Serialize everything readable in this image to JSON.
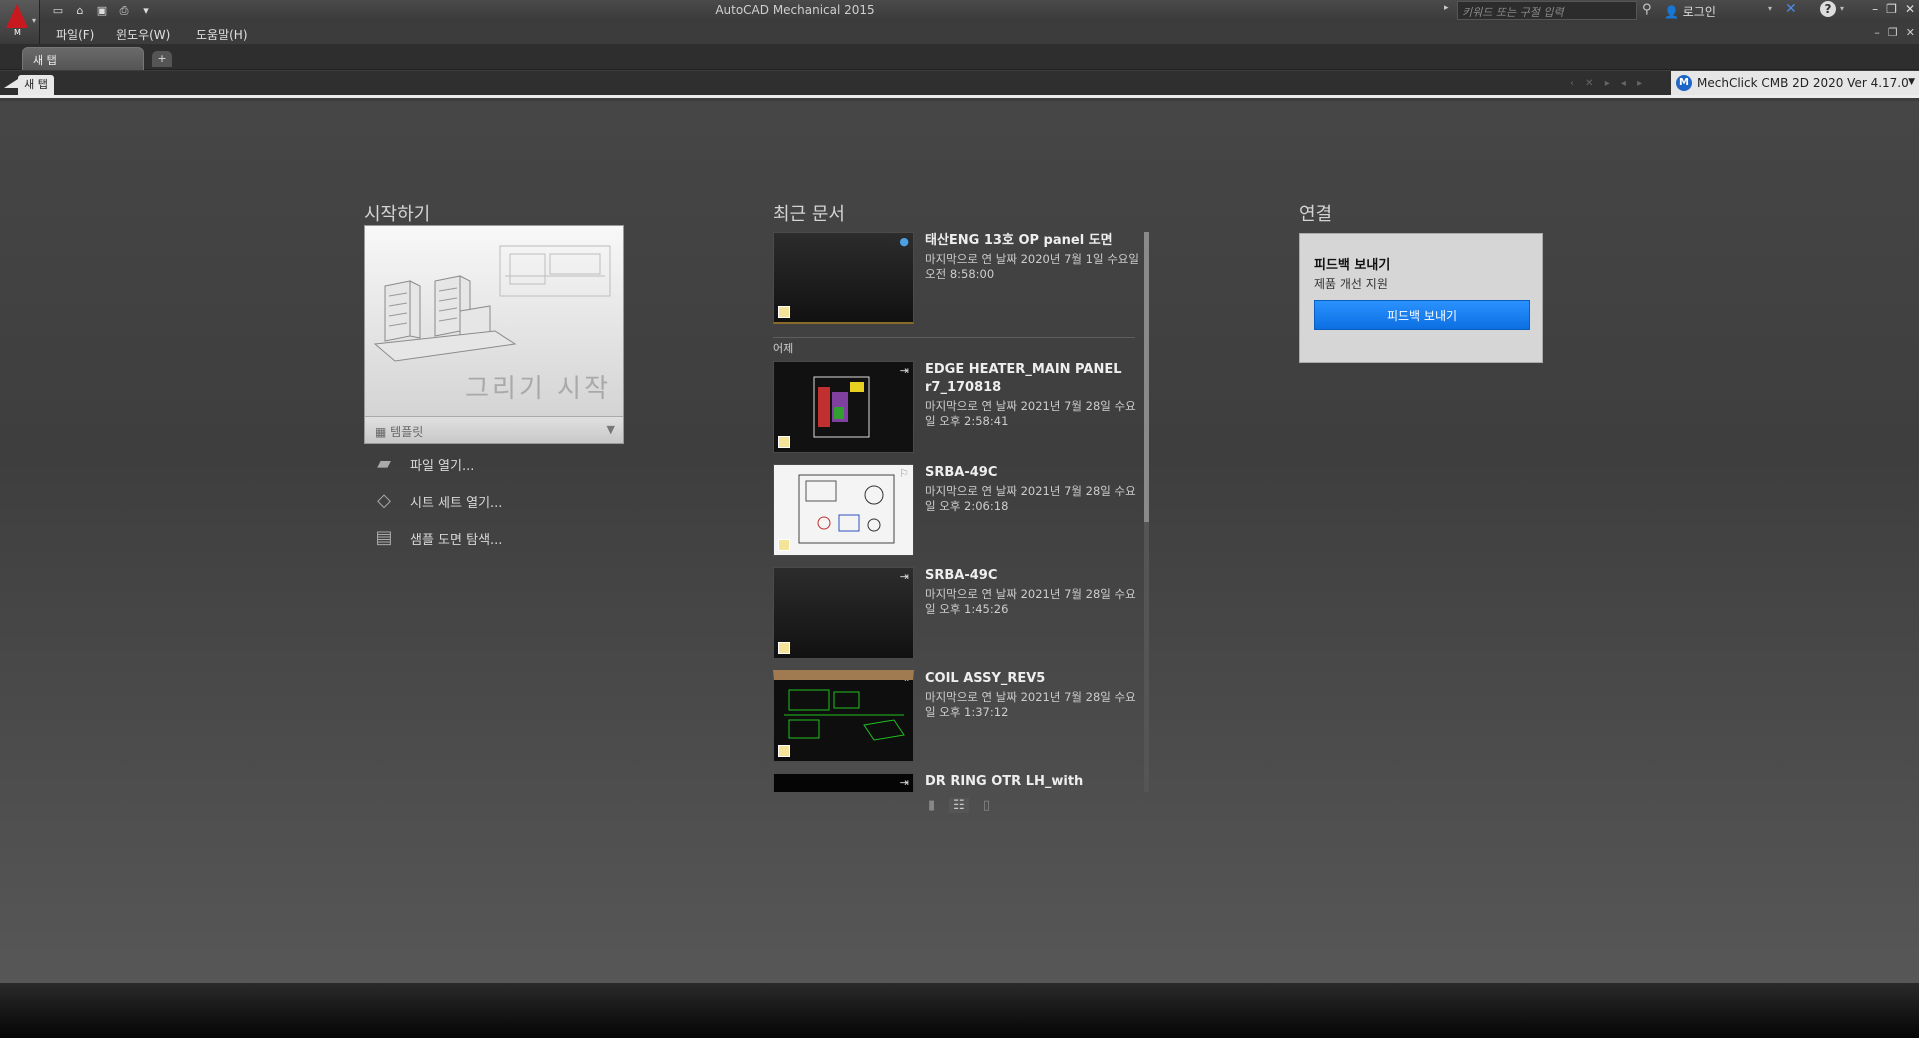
{
  "window": {
    "title": "AutoCAD Mechanical 2015",
    "search_placeholder": "키워드 또는 구절 입력",
    "login_label": "로그인"
  },
  "menu": {
    "items": [
      "파일(F)",
      "윈도우(W)",
      "도움말(H)"
    ]
  },
  "file_tabs": {
    "active": "새 탭",
    "add": "+"
  },
  "doc_tabs": {
    "active": "새 탭",
    "plugin": "MechClick CMB 2D 2020  Ver 4.17.0"
  },
  "start": {
    "title": "시작하기",
    "card_label": "그리기 시작",
    "template_label": "템플릿",
    "links": [
      "파일 열기...",
      "시트 세트 열기...",
      "샘플 도면 탐색..."
    ]
  },
  "recent": {
    "title": "최근 문서",
    "group_label": "어제",
    "items": [
      {
        "name": "태산ENG 13호 OP panel 도면",
        "meta": "마지막으로 연 날짜 2020년 7월 1일 수요일 오전 8:58:00"
      },
      {
        "name": "EDGE HEATER_MAIN PANEL r7_170818",
        "meta": "마지막으로 연 날짜 2021년 7월 28일 수요일 오후 2:58:41"
      },
      {
        "name": "SRBA-49C",
        "meta": "마지막으로 연 날짜 2021년 7월 28일 수요일 오후 2:06:18"
      },
      {
        "name": "SRBA-49C",
        "meta": "마지막으로 연 날짜 2021년 7월 28일 수요일 오후 1:45:26"
      },
      {
        "name": "COIL ASSY_REV5",
        "meta": "마지막으로 연 날짜 2021년 7월 28일 수요일 오후 1:37:12"
      },
      {
        "name": "DR RING OTR LH_with",
        "meta": ""
      }
    ]
  },
  "connect": {
    "title": "연결",
    "feedback_title": "피드백 보내기",
    "feedback_sub": "제품 개선 지원",
    "feedback_button": "피드백 보내기"
  },
  "colors": {
    "accent": "#1a7ff0",
    "autocad_red": "#c8191e"
  }
}
